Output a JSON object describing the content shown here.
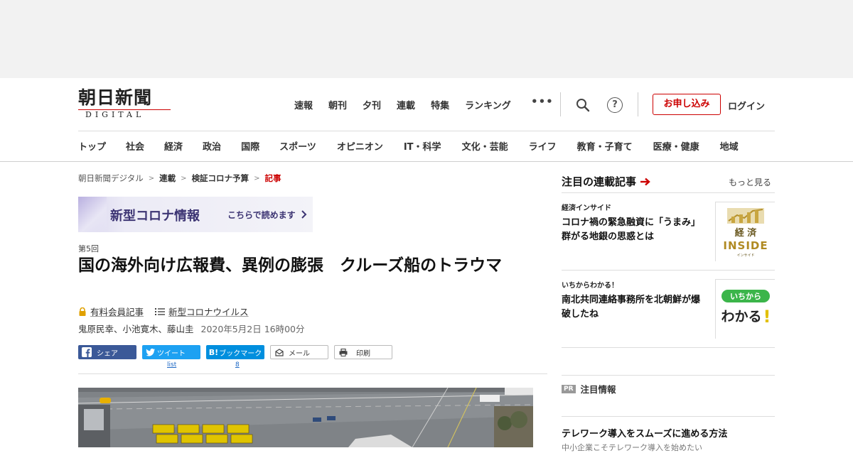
{
  "logo": {
    "jp": "朝日新聞",
    "en": "DIGITAL"
  },
  "topnav": [
    "速報",
    "朝刊",
    "夕刊",
    "連載",
    "特集",
    "ランキング"
  ],
  "header": {
    "more": "•••",
    "help": "?",
    "apply": "お申し込み",
    "login": "ログイン"
  },
  "categories": [
    "トップ",
    "社会",
    "経済",
    "政治",
    "国際",
    "スポーツ",
    "オピニオン",
    "IT・科学",
    "文化・芸能",
    "ライフ",
    "教育・子育て",
    "医療・健康",
    "地域"
  ],
  "breadcrumb": {
    "home": "朝日新聞デジタル",
    "series": "連載",
    "topic": "検証コロナ予算",
    "current": "記事",
    "sep": ">"
  },
  "banner": {
    "title": "新型コロナ情報",
    "link": "こちらで読めます"
  },
  "article": {
    "series_no": "第5回",
    "title": "国の海外向け広報費、異例の膨張　クルーズ船のトラウマ",
    "tag_member": "有料会員記事",
    "tag_topic": "新型コロナウイルス",
    "authors": "鬼原民幸、小池寛木、藤山圭",
    "date": "2020年5月2日 16時00分"
  },
  "share": {
    "facebook": "シェア",
    "tweet": "ツイート",
    "hatena": "ブックマーク",
    "hatena_badge": "B!",
    "mail": "メール",
    "print": "印刷",
    "tweet_count": "list",
    "hatena_count": "8"
  },
  "sidebar": {
    "heading": "注目の連載記事",
    "more": "もっと見る",
    "items": [
      {
        "kicker": "経済インサイド",
        "title": "コロナ禍の緊急融資に「うまみ」　群がる地銀の思惑とは",
        "thumb_top": "経 済",
        "thumb_bottom": "INSIDE",
        "thumb_tiny": "インサイド"
      },
      {
        "kicker": "いちからわかる！",
        "title": "南北共同連絡事務所を北朝鮮が爆破したね",
        "thumb_top": "いちから",
        "thumb_bottom": "わかる",
        "thumb_mark": "!"
      }
    ],
    "pr_badge": "PR",
    "pr_heading": "注目情報",
    "pr_title": "テレワーク導入をスムーズに進める方法",
    "pr_sub": "中小企業こそテレワーク導入を始めたい"
  },
  "colors": {
    "accent": "#cc0000",
    "facebook": "#3b5998",
    "twitter": "#1da1f2",
    "hatena": "#008fde",
    "banner_text": "#3c3473"
  },
  "icons": [
    "search-icon",
    "help-icon",
    "lock-icon",
    "list-icon",
    "facebook-icon",
    "twitter-icon",
    "hatena-icon",
    "mail-icon",
    "print-icon",
    "arrow-right-icon"
  ]
}
